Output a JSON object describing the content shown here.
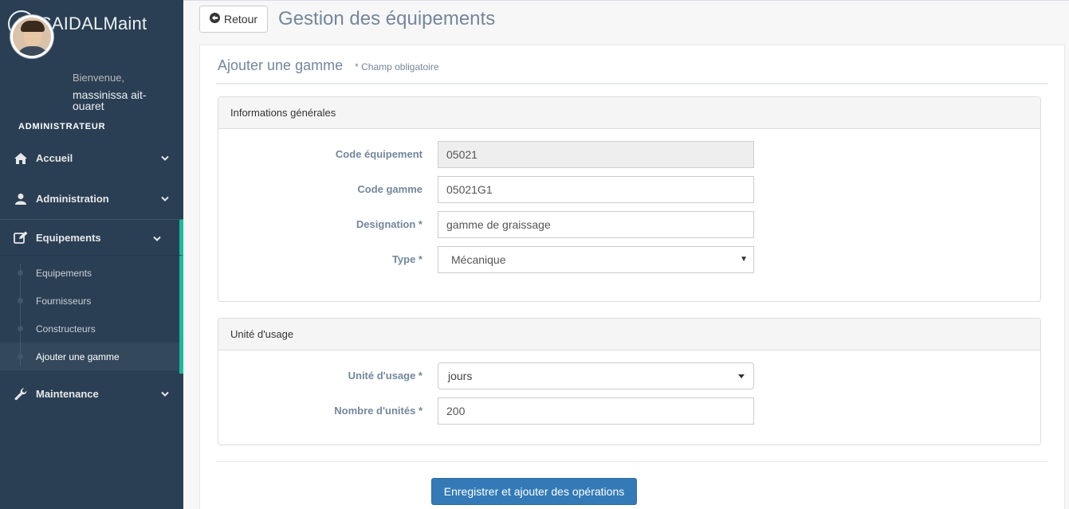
{
  "app": {
    "title": "SAIDALMaint",
    "logo_icon": "paw-icon"
  },
  "profile": {
    "welcome": "Bienvenue,",
    "name": "massinissa ait-ouaret",
    "role": "ADMINISTRATEUR"
  },
  "sidebar": {
    "accent": "#1ABB9C",
    "background": "#2A3F54",
    "items": [
      {
        "label": "Accueil",
        "icon": "home-icon"
      },
      {
        "label": "Administration",
        "icon": "user-icon"
      },
      {
        "label": "Equipements",
        "icon": "edit-icon",
        "active": true
      },
      {
        "label": "Maintenance",
        "icon": "wrench-icon"
      }
    ],
    "submenu": [
      {
        "label": "Equipements"
      },
      {
        "label": "Fournisseurs"
      },
      {
        "label": "Constructeurs"
      },
      {
        "label": "Ajouter une gamme",
        "current": true
      }
    ]
  },
  "header": {
    "back_label": "Retour",
    "page_title": "Gestion des équipements"
  },
  "form": {
    "title": "Ajouter une gamme",
    "required_note": "* Champ obligatoire",
    "general": {
      "title": "Informations générales",
      "code_equipement": {
        "label": "Code équipement",
        "value": "05021"
      },
      "code_gamme": {
        "label": "Code gamme",
        "value": "05021G1"
      },
      "designation": {
        "label": "Designation *",
        "value": "gamme de graissage"
      },
      "type": {
        "label": "Type *",
        "value": "Mécanique"
      }
    },
    "usage": {
      "title": "Unité d'usage",
      "unite": {
        "label": "Unité d'usage *",
        "value": "jours"
      },
      "nombre": {
        "label": "Nombre d'unités *",
        "value": "200"
      }
    },
    "submit_label": "Enregistrer et ajouter des opérations",
    "submit_color": "#337AB7"
  }
}
